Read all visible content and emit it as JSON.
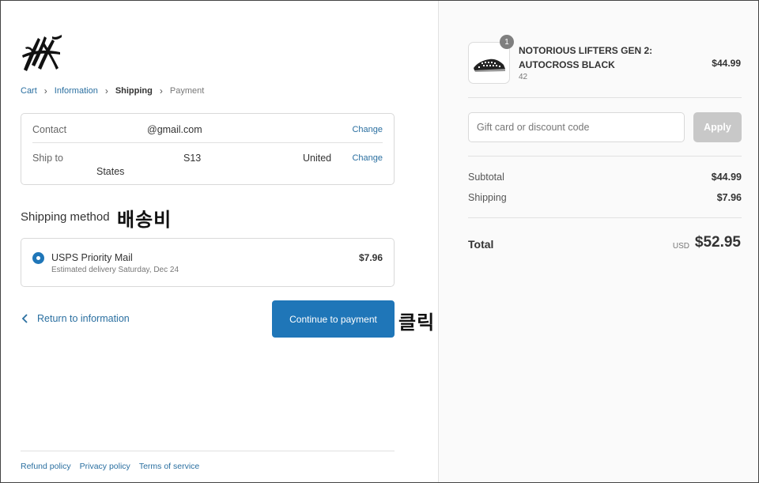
{
  "breadcrumb": {
    "cart": "Cart",
    "information": "Information",
    "shipping": "Shipping",
    "payment": "Payment"
  },
  "review": {
    "contact_label": "Contact",
    "contact_value": "@gmail.com",
    "ship_to_label": "Ship to",
    "ship_to_part1": "S13",
    "ship_to_part2": "United",
    "ship_to_part3": "States",
    "change_label": "Change"
  },
  "shipping_method": {
    "title": "Shipping method",
    "annotation": "배송비",
    "option_name": "USPS Priority Mail",
    "option_detail": "Estimated delivery Saturday, Dec 24",
    "option_price": "$7.96"
  },
  "actions": {
    "return_label": "Return to information",
    "continue_label": "Continue to payment",
    "annotation": "클릭"
  },
  "footer": {
    "refund": "Refund policy",
    "privacy": "Privacy policy",
    "terms": "Terms of service"
  },
  "cart": {
    "quantity": "1",
    "product_name": "NOTORIOUS LIFTERS GEN 2: AUTOCROSS BLACK",
    "variant": "42",
    "price": "$44.99"
  },
  "discount": {
    "placeholder": "Gift card or discount code",
    "apply_label": "Apply"
  },
  "summary": {
    "subtotal_label": "Subtotal",
    "subtotal_value": "$44.99",
    "shipping_label": "Shipping",
    "shipping_value": "$7.96",
    "total_label": "Total",
    "currency": "USD",
    "total_value": "$52.95"
  },
  "colors": {
    "accent": "#1f76b8",
    "link": "#2a6fa0",
    "apply_disabled": "#c8c8c8"
  },
  "icons": [
    "brand-logo-icon",
    "chevron-right-icon",
    "chevron-left-icon",
    "radio-selected-icon",
    "shoe-thumbnail"
  ]
}
